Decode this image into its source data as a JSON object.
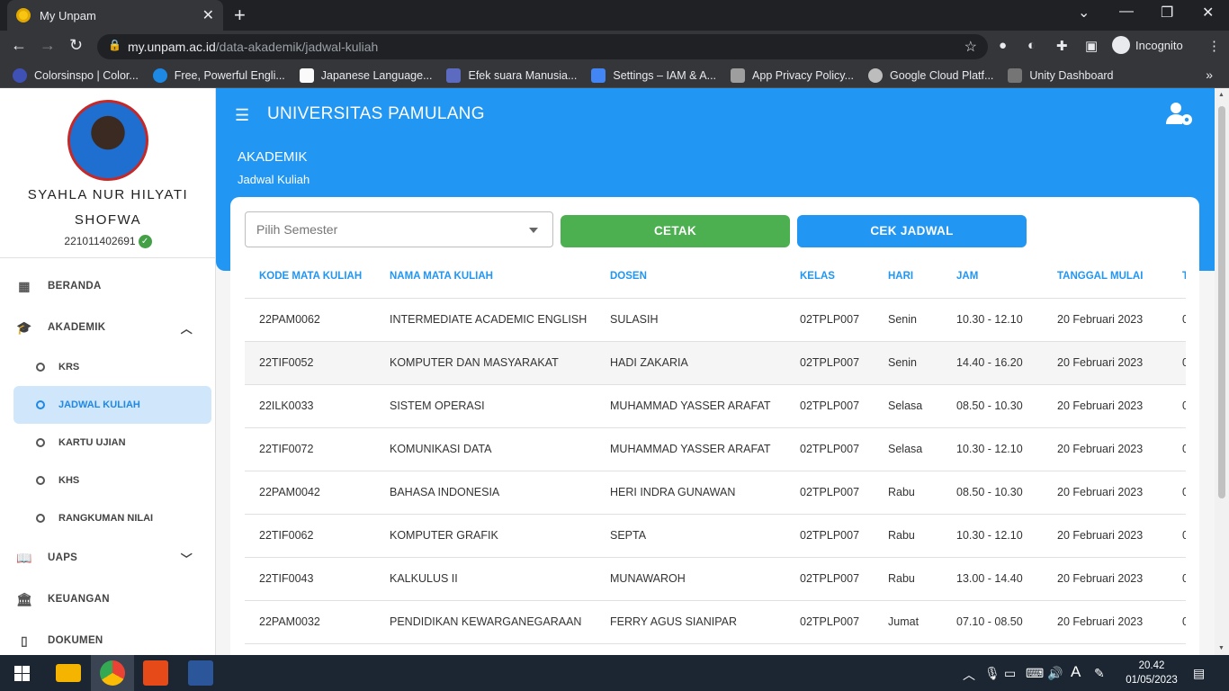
{
  "browser": {
    "tab_title": "My Unpam",
    "new_tab": "+",
    "url_host": "my.unpam.ac.id",
    "url_path": "/data-akademik/jadwal-kuliah",
    "profile_label": "Incognito",
    "bookmarks": [
      {
        "label": "Colorsinspo | Color...",
        "color": "#3f51b5"
      },
      {
        "label": "Free, Powerful Engli...",
        "color": "#1e88e5"
      },
      {
        "label": "Japanese Language...",
        "color": "#fafafa"
      },
      {
        "label": "Efek suara Manusia...",
        "color": "#5c6bc0"
      },
      {
        "label": "Settings – IAM & A...",
        "color": "#4285f4"
      },
      {
        "label": "App Privacy Policy...",
        "color": "#9e9e9e"
      },
      {
        "label": "Google Cloud Platf...",
        "color": "#bdbdbd"
      },
      {
        "label": "Unity Dashboard",
        "color": "#757575"
      }
    ],
    "bookmarks_more": "»"
  },
  "user": {
    "name": "SYAHLA NUR HILYATI SHOFWA",
    "nim": "221011402691"
  },
  "sidebar": {
    "items": [
      {
        "label": "BERANDA",
        "icon": "dashboard-icon"
      },
      {
        "label": "AKADEMIK",
        "icon": "school-icon"
      },
      {
        "label": "UAPS",
        "icon": "book-icon"
      },
      {
        "label": "KEUANGAN",
        "icon": "bank-icon"
      },
      {
        "label": "DOKUMEN",
        "icon": "document-icon"
      }
    ],
    "akademik_sub": [
      {
        "label": "KRS"
      },
      {
        "label": "JADWAL KULIAH"
      },
      {
        "label": "KARTU UJIAN"
      },
      {
        "label": "KHS"
      },
      {
        "label": "RANGKUMAN NILAI"
      }
    ]
  },
  "header": {
    "brand": "UNIVERSITAS PAMULANG",
    "section": "AKADEMIK",
    "subsection": "Jadwal Kuliah"
  },
  "toolbar": {
    "semester_placeholder": "Pilih Semester",
    "cetak_label": "CETAK",
    "cek_label": "CEK JADWAL"
  },
  "table": {
    "columns": [
      "KODE MATA KULIAH",
      "NAMA MATA KULIAH",
      "DOSEN",
      "KELAS",
      "HARI",
      "JAM",
      "TANGGAL MULAI",
      "T"
    ],
    "rows": [
      [
        "22PAM0062",
        "INTERMEDIATE ACADEMIC ENGLISH",
        "SULASIH",
        "02TPLP007",
        "Senin",
        "10.30 - 12.10",
        "20 Februari 2023",
        "0"
      ],
      [
        "22TIF0052",
        "KOMPUTER DAN MASYARAKAT",
        "HADI ZAKARIA",
        "02TPLP007",
        "Senin",
        "14.40 - 16.20",
        "20 Februari 2023",
        "0"
      ],
      [
        "22ILK0033",
        "SISTEM OPERASI",
        "MUHAMMAD YASSER ARAFAT",
        "02TPLP007",
        "Selasa",
        "08.50 - 10.30",
        "20 Februari 2023",
        "0"
      ],
      [
        "22TIF0072",
        "KOMUNIKASI DATA",
        "MUHAMMAD YASSER ARAFAT",
        "02TPLP007",
        "Selasa",
        "10.30 - 12.10",
        "20 Februari 2023",
        "0"
      ],
      [
        "22PAM0042",
        "BAHASA INDONESIA",
        "HERI INDRA GUNAWAN",
        "02TPLP007",
        "Rabu",
        "08.50 - 10.30",
        "20 Februari 2023",
        "0"
      ],
      [
        "22TIF0062",
        "KOMPUTER GRAFIK",
        "SEPTA",
        "02TPLP007",
        "Rabu",
        "10.30 - 12.10",
        "20 Februari 2023",
        "0"
      ],
      [
        "22TIF0043",
        "KALKULUS II",
        "MUNAWAROH",
        "02TPLP007",
        "Rabu",
        "13.00 - 14.40",
        "20 Februari 2023",
        "0"
      ],
      [
        "22PAM0032",
        "PENDIDIKAN KEWARGANEGARAAN",
        "FERRY AGUS SIANIPAR",
        "02TPLP007",
        "Jumat",
        "07.10 - 08.50",
        "20 Februari 2023",
        "0"
      ]
    ]
  },
  "taskbar": {
    "time": "20.42",
    "date": "01/05/2023"
  }
}
